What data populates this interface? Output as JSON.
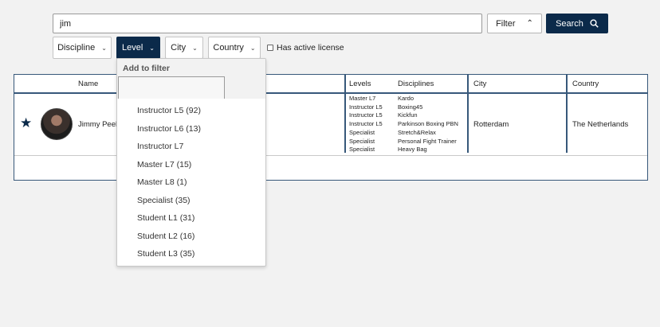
{
  "search": {
    "value": "jim"
  },
  "toolbar": {
    "filter_label": "Filter",
    "search_label": "Search"
  },
  "chips": {
    "discipline": "Discipline",
    "level": "Level",
    "city": "City",
    "country": "Country"
  },
  "license_label": "Has active license",
  "table": {
    "headers": {
      "name": "Name",
      "levels": "Levels",
      "disciplines": "Disciplines",
      "city": "City",
      "country": "Country"
    },
    "row": {
      "name": "Jimmy Peek",
      "levels": [
        "Master L7",
        "Instructor L5",
        "Instructor L5",
        "Instructor L5",
        "Specialist",
        "Specialist",
        "Specialist"
      ],
      "disciplines": [
        "Kardo",
        "Boxing45",
        "Kickfun",
        "Parkinson Boxing PBN",
        "Stretch&Relax",
        "Personal Fight Trainer",
        "Heavy Bag"
      ],
      "city": "Rotterdam",
      "country": "The Netherlands"
    }
  },
  "dropdown": {
    "title": "Add to filter",
    "items": [
      "Instructor L5 (92)",
      "Instructor L6 (13)",
      "Instructor L7",
      "Master L7 (15)",
      "Master L8 (1)",
      "Specialist (35)",
      "Student L1 (31)",
      "Student L2 (16)",
      "Student L3 (35)"
    ]
  },
  "colors": {
    "navy": "#0b2a4a",
    "border_blue": "#37587a"
  }
}
